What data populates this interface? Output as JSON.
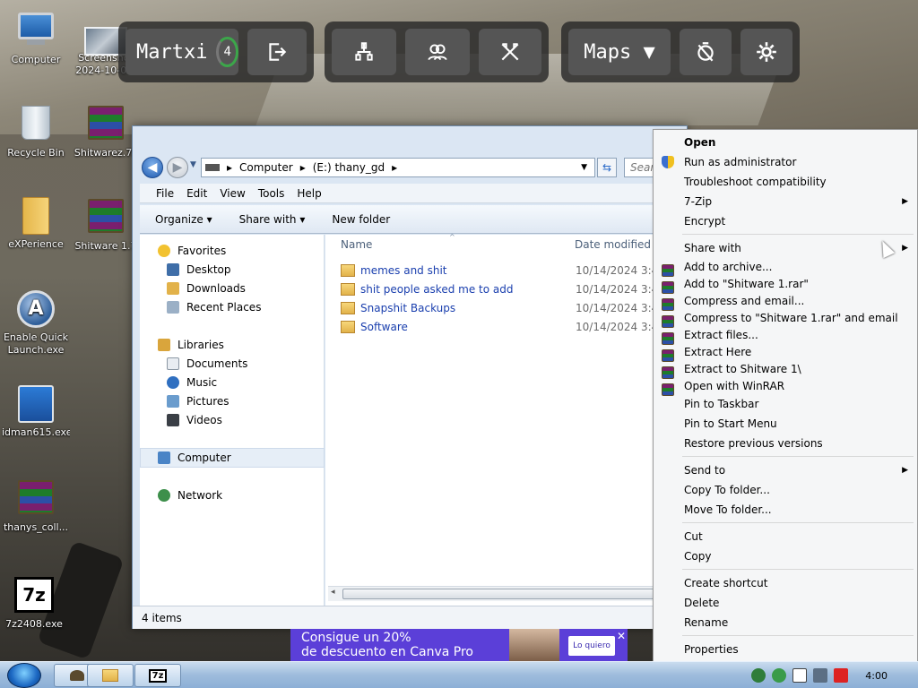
{
  "desktop": {
    "icons": [
      {
        "label": "Computer"
      },
      {
        "label": "Screenshot 2024-10-0..."
      },
      {
        "label": "Recycle Bin"
      },
      {
        "label": "Shitwarez.7z"
      },
      {
        "label": "eXPerience"
      },
      {
        "label": "Shitware 1.7"
      },
      {
        "label": "Enable Quick Launch.exe"
      },
      {
        "label": "idman615.exe"
      },
      {
        "label": "thanys_coll..."
      },
      {
        "label": "7z2408.exe"
      }
    ]
  },
  "overlay": {
    "username": "Martxi",
    "counter": "4",
    "maps_label": "Maps ▼"
  },
  "explorer": {
    "breadcrumb": [
      "Computer",
      "(E:) thany_gd"
    ],
    "search_placeholder": "Sear",
    "menu": [
      "File",
      "Edit",
      "View",
      "Tools",
      "Help"
    ],
    "commands": [
      "Organize ▾",
      "Share with ▾",
      "New folder"
    ],
    "nav": {
      "favorites": "Favorites",
      "favorites_items": [
        "Desktop",
        "Downloads",
        "Recent Places"
      ],
      "libraries": "Libraries",
      "libraries_items": [
        "Documents",
        "Music",
        "Pictures",
        "Videos"
      ],
      "computer": "Computer",
      "network": "Network"
    },
    "columns": {
      "name": "Name",
      "date": "Date modified"
    },
    "files": [
      {
        "name": "memes and shit",
        "date": "10/14/2024 3:41 ..."
      },
      {
        "name": "shit people asked me to add",
        "date": "10/14/2024 3:41 ..."
      },
      {
        "name": "Snapshit Backups",
        "date": "10/14/2024 3:41 ..."
      },
      {
        "name": "Software",
        "date": "10/14/2024 3:43 ..."
      }
    ],
    "status": "4 items"
  },
  "context_menu": {
    "items": [
      {
        "label": "Open"
      },
      {
        "label": "Run as administrator"
      },
      {
        "label": "Troubleshoot compatibility"
      },
      {
        "label": "7-Zip"
      },
      {
        "label": "Encrypt"
      },
      {
        "label": "Share with"
      },
      {
        "label": "Add to archive..."
      },
      {
        "label": "Add to \"Shitware 1.rar\""
      },
      {
        "label": "Compress and email..."
      },
      {
        "label": "Compress to \"Shitware 1.rar\" and email"
      },
      {
        "label": "Extract files..."
      },
      {
        "label": "Extract Here"
      },
      {
        "label": "Extract to Shitware 1\\"
      },
      {
        "label": "Open with WinRAR"
      },
      {
        "label": "Pin to Taskbar"
      },
      {
        "label": "Pin to Start Menu"
      },
      {
        "label": "Restore previous versions"
      },
      {
        "label": "Send to"
      },
      {
        "label": "Copy To folder..."
      },
      {
        "label": "Move To folder..."
      },
      {
        "label": "Cut"
      },
      {
        "label": "Copy"
      },
      {
        "label": "Create shortcut"
      },
      {
        "label": "Delete"
      },
      {
        "label": "Rename"
      },
      {
        "label": "Properties"
      }
    ]
  },
  "ad": {
    "line1": "Consigue un 20%",
    "line2": "de descuento en Canva Pro",
    "cta": "Lo quiero"
  },
  "taskbar": {
    "pinned": [
      "explorer-icon",
      "folder-icon",
      "7z"
    ],
    "clock": "4:00"
  },
  "colors": {
    "accent": "#1a3fae",
    "ad_bg": "#5b3fd8",
    "overlay_green": "#3ca64a"
  }
}
